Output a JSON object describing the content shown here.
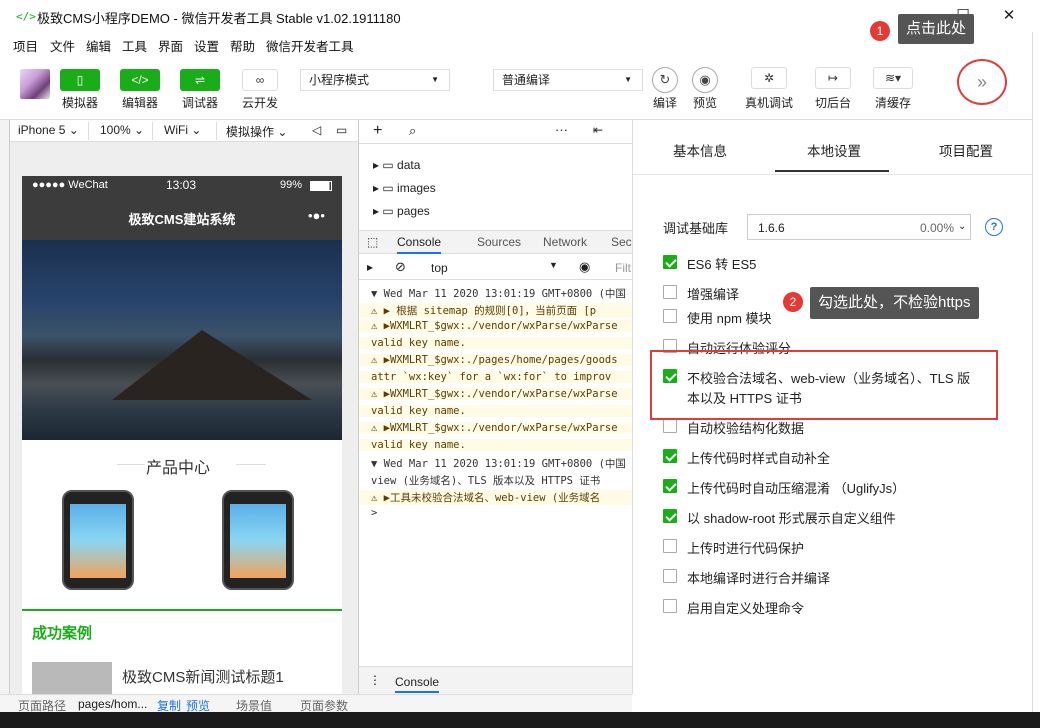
{
  "window": {
    "logo": "</>",
    "title": "极致CMS小程序DEMO - 微信开发者工具 Stable v1.02.1911180",
    "min": "—",
    "max": "☐",
    "close": "✕"
  },
  "menu": [
    "项目",
    "文件",
    "编辑",
    "工具",
    "界面",
    "设置",
    "帮助",
    "微信开发者工具"
  ],
  "toolbar": {
    "simulator": "模拟器",
    "editor": "编辑器",
    "debugger": "调试器",
    "cloud": "云开发",
    "mode_select": "小程序模式",
    "compile_select": "普通编译",
    "compile": "编译",
    "preview": "预览",
    "remote_debug": "真机调试",
    "background": "切后台",
    "clear_cache": "清缓存"
  },
  "simbar": {
    "device": "iPhone 5",
    "zoom": "100%",
    "network": "WiFi",
    "ops": "模拟操作"
  },
  "phone": {
    "carrier": "●●●●● WeChat",
    "time": "13:03",
    "battery": "99%",
    "nav_title": "极致CMS建站系统",
    "nav_dots": "•●•",
    "section_title": "产品中心",
    "cases_title": "成功案例",
    "news_title": "极致CMS新闻测试标题1"
  },
  "devtools": {
    "tree": [
      "data",
      "images",
      "pages"
    ],
    "tabs": [
      "Console",
      "Sources",
      "Network",
      "Sec"
    ],
    "context": "top",
    "filter": "Filt",
    "lines": [
      {
        "t": "▼ Wed Mar 11 2020 13:01:19 GMT+0800 (中国",
        "w": false
      },
      {
        "t": "⚠ ▶ 根据 sitemap 的规则[0]，当前页面 [p",
        "w": true
      },
      {
        "t": "⚠ ▶WXMLRT_$gwx:./vendor/wxParse/wxParse",
        "w": true
      },
      {
        "t": "   valid key name.",
        "w": true
      },
      {
        "t": "⚠ ▶WXMLRT_$gwx:./pages/home/pages/goods",
        "w": true
      },
      {
        "t": "   attr `wx:key` for a `wx:for` to improv",
        "w": true
      },
      {
        "t": "⚠ ▶WXMLRT_$gwx:./vendor/wxParse/wxParse",
        "w": true
      },
      {
        "t": "   valid key name.",
        "w": true
      },
      {
        "t": "⚠ ▶WXMLRT_$gwx:./vendor/wxParse/wxParse",
        "w": true
      },
      {
        "t": "   valid key name.",
        "w": true
      },
      {
        "t": "▼ Wed Mar 11 2020 13:01:19 GMT+0800 (中国",
        "w": false
      },
      {
        "t": "   view (业务域名)、TLS 版本以及 HTTPS 证书",
        "w": false
      },
      {
        "t": "⚠ ▶工具未校验合法域名、web-view (业务域名",
        "w": true
      },
      {
        "t": ">",
        "w": false
      }
    ],
    "bottom_tab": "Console"
  },
  "panel": {
    "tabs": [
      "基本信息",
      "本地设置",
      "项目配置"
    ],
    "lib_label": "调试基础库",
    "lib_version": "1.6.6",
    "lib_percent": "0.00%",
    "options": [
      {
        "label": "ES6 转 ES5",
        "on": true
      },
      {
        "label": "增强编译",
        "on": false
      },
      {
        "label": "使用 npm 模块",
        "on": false
      },
      {
        "label": "自动运行体验评分",
        "on": false
      },
      {
        "label": "不校验合法域名、web-view（业务域名）、TLS 版",
        "on": true
      },
      {
        "label": "自动校验结构化数据",
        "on": false
      },
      {
        "label": "上传代码时样式自动补全",
        "on": true
      },
      {
        "label": "上传代码时自动压缩混淆 （UglifyJs）",
        "on": true
      },
      {
        "label": "以 shadow-root 形式展示自定义组件",
        "on": true
      },
      {
        "label": "上传时进行代码保护",
        "on": false
      },
      {
        "label": "本地编译时进行合并编译",
        "on": false
      },
      {
        "label": "启用自定义处理命令",
        "on": false
      }
    ],
    "option4_line2": "本以及 HTTPS 证书"
  },
  "callouts": {
    "c1_num": "1",
    "c1_text": "点击此处",
    "c2_num": "2",
    "c2_text": "勾选此处，不检验https"
  },
  "statusbar": {
    "path_label": "页面路径",
    "path": "pages/hom...",
    "copy": "复制",
    "preview": "预览",
    "scene": "场景值",
    "params": "页面参数"
  }
}
